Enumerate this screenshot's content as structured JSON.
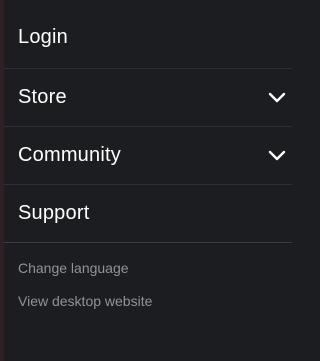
{
  "menu": {
    "items": [
      {
        "label": "Login",
        "icon": null
      },
      {
        "label": "Store",
        "icon": "chevron-down-icon"
      },
      {
        "label": "Community",
        "icon": "chevron-down-icon"
      },
      {
        "label": "Support",
        "icon": null
      }
    ]
  },
  "footer_links": {
    "change_language": "Change language",
    "view_desktop": "View desktop website"
  },
  "colors": {
    "background": "#1b1d21",
    "text_primary": "#ffffff",
    "text_secondary": "#8f949b",
    "divider": "#2c2f35"
  }
}
